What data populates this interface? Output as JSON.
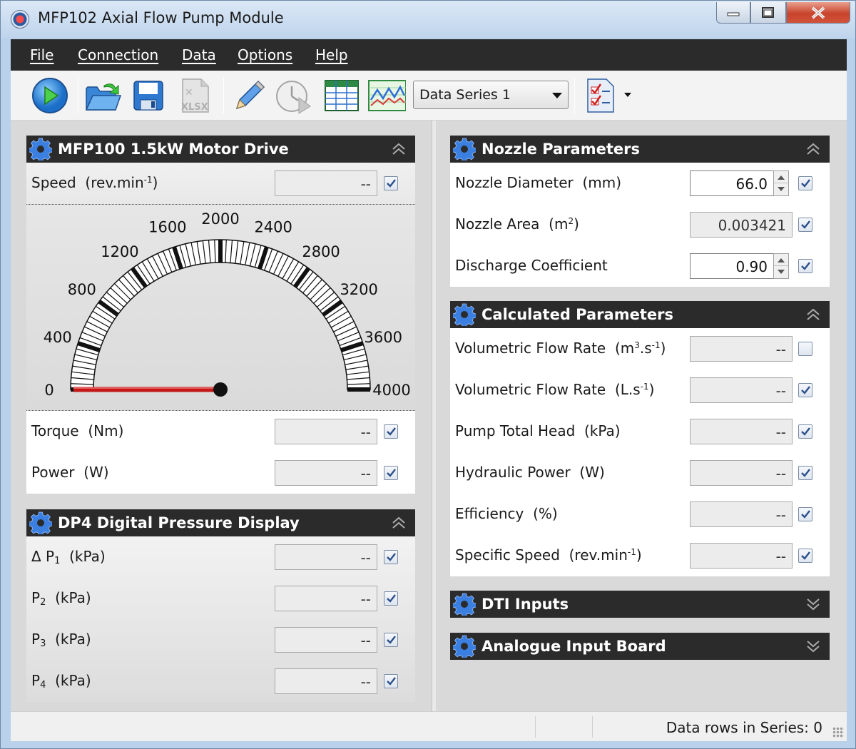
{
  "window": {
    "title": "MFP102 Axial Flow Pump Module"
  },
  "menu": [
    {
      "label": "File"
    },
    {
      "label": "Connection"
    },
    {
      "label": "Data"
    },
    {
      "label": "Options"
    },
    {
      "label": "Help"
    }
  ],
  "toolbar": {
    "icons": [
      "play-icon",
      "open-folder-icon",
      "save-icon",
      "export-xlsx-icon",
      "edit-pencil-icon",
      "timer-icon",
      "table-icon",
      "chart-icon",
      "report-icon"
    ],
    "xlsx_label": "XLSX",
    "series_select": "Data Series 1"
  },
  "motor_drive": {
    "title": "MFP100 1.5kW Motor Drive",
    "speed": {
      "label": "Speed",
      "unit_prefix": "(rev.min",
      "unit_sup": "-1",
      "unit_suffix": ")",
      "value": "--",
      "checked": true
    },
    "gauge": {
      "min": 0,
      "max": 4000,
      "value": 0,
      "ticks": [
        "0",
        "400",
        "800",
        "1200",
        "1600",
        "2000",
        "2400",
        "2800",
        "3200",
        "3600",
        "4000"
      ]
    },
    "torque": {
      "label": "Torque",
      "unit": "(Nm)",
      "value": "--",
      "checked": true
    },
    "power": {
      "label": "Power",
      "unit": "(W)",
      "value": "--",
      "checked": true
    }
  },
  "dp4": {
    "title": "DP4 Digital Pressure Display",
    "rows": [
      {
        "prefix": "Δ P",
        "sub": "1",
        "unit": "(kPa)",
        "value": "--",
        "checked": true
      },
      {
        "prefix": "P",
        "sub": "2",
        "unit": "(kPa)",
        "value": "--",
        "checked": true
      },
      {
        "prefix": "P",
        "sub": "3",
        "unit": "(kPa)",
        "value": "--",
        "checked": true
      },
      {
        "prefix": "P",
        "sub": "4",
        "unit": "(kPa)",
        "value": "--",
        "checked": true
      }
    ]
  },
  "nozzle": {
    "title": "Nozzle Parameters",
    "diameter": {
      "label": "Nozzle Diameter",
      "unit": "(mm)",
      "value": "66.0",
      "checked": true
    },
    "area": {
      "label": "Nozzle Area",
      "unit_prefix": "(m",
      "unit_sup": "2",
      "unit_suffix": ")",
      "value": "0.003421",
      "checked": true
    },
    "coefficient": {
      "label": "Discharge Coefficient",
      "value": "0.90",
      "checked": true
    }
  },
  "calculated": {
    "title": "Calculated Parameters",
    "flow_m3": {
      "label": "Volumetric Flow Rate",
      "u1": "(m",
      "s1": "3",
      "u2": ".s",
      "s2": "-1",
      "u3": ")",
      "value": "--",
      "checked": false
    },
    "flow_l": {
      "label": "Volumetric Flow Rate",
      "u1": "(L.s",
      "s1": "-1",
      "u2": ")",
      "value": "--",
      "checked": true
    },
    "head": {
      "label": "Pump Total Head",
      "unit": "(kPa)",
      "value": "--",
      "checked": true
    },
    "hydraulic": {
      "label": "Hydraulic Power",
      "unit": "(W)",
      "value": "--",
      "checked": true
    },
    "efficiency": {
      "label": "Efficiency",
      "unit": "(%)",
      "value": "--",
      "checked": true
    },
    "specific_speed": {
      "label": "Specific Speed",
      "u1": "(rev.min",
      "s1": "-1",
      "u2": ")",
      "value": "--",
      "checked": true
    }
  },
  "dti": {
    "title": "DTI Inputs"
  },
  "analogue": {
    "title": "Analogue Input Board"
  },
  "status": {
    "text": "Data rows in Series: 0"
  },
  "colors": {
    "panel_header": "#2b2b2b",
    "gear": "#2f6fd6",
    "needle": "#c41818",
    "menubar": "#2b2b2b"
  }
}
